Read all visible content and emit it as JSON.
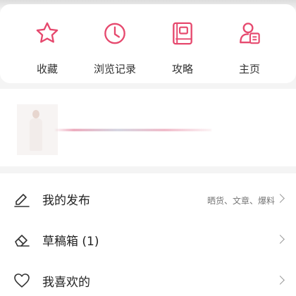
{
  "accent_color": "#e6496e",
  "quick_actions": [
    {
      "label": "收藏",
      "icon": "star-icon"
    },
    {
      "label": "浏览记录",
      "icon": "clock-icon"
    },
    {
      "label": "攻略",
      "icon": "guide-book-icon"
    },
    {
      "label": "主页",
      "icon": "profile-card-icon"
    }
  ],
  "promo": {
    "thumbnail": "model-photo-thumbnail"
  },
  "menu": [
    {
      "label": "我的发布",
      "hint": "晒货、文章、爆料",
      "icon": "pencil-icon"
    },
    {
      "label": "草稿箱 (1)",
      "hint": "",
      "icon": "eraser-icon"
    },
    {
      "label": "我喜欢的",
      "hint": "",
      "icon": "heart-icon"
    }
  ]
}
